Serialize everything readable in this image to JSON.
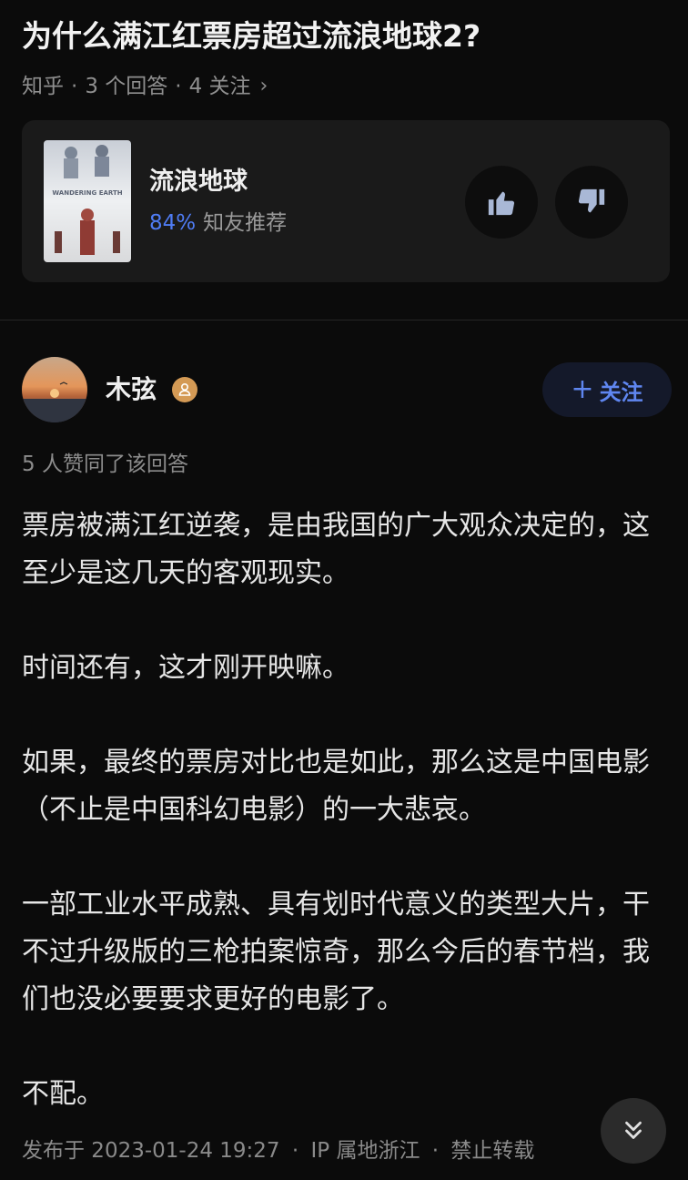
{
  "question": {
    "title": "为什么满江红票房超过流浪地球2?",
    "source": "知乎",
    "answers": "3 个回答",
    "follows": "4 关注",
    "separator": "·"
  },
  "movie": {
    "name": "流浪地球",
    "recommend_pct": "84%",
    "recommend_label": "知友推荐",
    "poster_title": "WANDERING EARTH",
    "upvote_icon": "thumbs-up-icon",
    "downvote_icon": "thumbs-down-icon"
  },
  "author": {
    "name": "木弦",
    "badge_icon": "person-badge-icon",
    "follow_plus": "+",
    "follow_label": "关注"
  },
  "answer": {
    "vote_text": "5 人赞同了该回答",
    "paragraphs": [
      "票房被满江红逆袭，是由我国的广大观众决定的，这至少是这几天的客观现实。",
      "时间还有，这才刚开映嘛。",
      "如果，最终的票房对比也是如此，那么这是中国电影（不止是中国科幻电影）的一大悲哀。",
      "一部工业水平成熟、具有划时代意义的类型大片，干不过升级版的三枪拍案惊奇，那么今后的春节档，我们也没必要要求更好的电影了。",
      "不配。"
    ]
  },
  "footer": {
    "published": "发布于 2023-01-24 19:27",
    "ip": "IP 属地浙江",
    "copyright": "禁止转载",
    "separator": "·"
  },
  "scroll_icon": "double-chevron-down-icon",
  "colors": {
    "background": "#0b0b0b",
    "card": "#1a1a1a",
    "accent": "#4f7cf4",
    "muted": "#8f8f8f"
  }
}
